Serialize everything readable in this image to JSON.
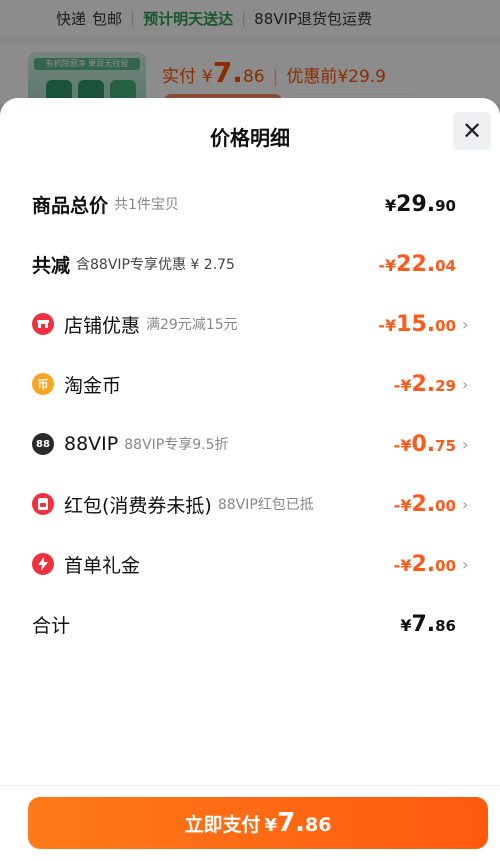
{
  "background": {
    "shipping": {
      "courier": "快递",
      "free_shipping": "包邮",
      "delivery": "预计明天送达",
      "vip_return": "88VIP退货包运费"
    },
    "product": {
      "thumb_banner": "有机除菌净 果蔬无残留",
      "price_label": "实付",
      "currency": "¥",
      "price_int": "7.",
      "price_dec": "86",
      "before_label": "优惠前",
      "before_price": "¥29.9"
    }
  },
  "sheet": {
    "title": "价格明细",
    "close_icon": "close-icon",
    "rows": [
      {
        "label": "商品总价",
        "sub": "共1件宝贝",
        "currency": "¥",
        "int": "29.",
        "dec": "90",
        "color": "black",
        "bold": true
      },
      {
        "label": "共减",
        "sub": "含88VIP专享优惠 ¥ 2.75",
        "currency": "-¥",
        "int": "22.",
        "dec": "04",
        "color": "orange",
        "bold": true
      },
      {
        "label": "店铺优惠",
        "sub": "满29元减15元",
        "currency": "-¥",
        "int": "15.",
        "dec": "00",
        "color": "orange",
        "icon": "store-icon"
      },
      {
        "label": "淘金币",
        "sub": "",
        "currency": "-¥",
        "int": "2.",
        "dec": "29",
        "color": "orange",
        "icon": "coin-icon"
      },
      {
        "label": "88VIP",
        "sub": "88VIP专享9.5折",
        "currency": "-¥",
        "int": "0.",
        "dec": "75",
        "color": "orange",
        "icon": "vip-icon",
        "icon_text": "88"
      },
      {
        "label": "红包(消费券未抵)",
        "sub": "88VIP红包已抵",
        "currency": "-¥",
        "int": "2.",
        "dec": "00",
        "color": "orange",
        "icon": "red-packet-icon"
      },
      {
        "label": "首单礼金",
        "sub": "",
        "currency": "-¥",
        "int": "2.",
        "dec": "00",
        "color": "orange",
        "icon": "bolt-icon"
      },
      {
        "label": "合计",
        "sub": "",
        "currency": "¥",
        "int": "7.",
        "dec": "86",
        "color": "black"
      }
    ]
  },
  "pay_button": {
    "label": "立即支付",
    "currency": "¥",
    "int": "7.",
    "dec": "86"
  },
  "colors": {
    "accent": "#ff5a1a",
    "button": "#ff6a14"
  }
}
